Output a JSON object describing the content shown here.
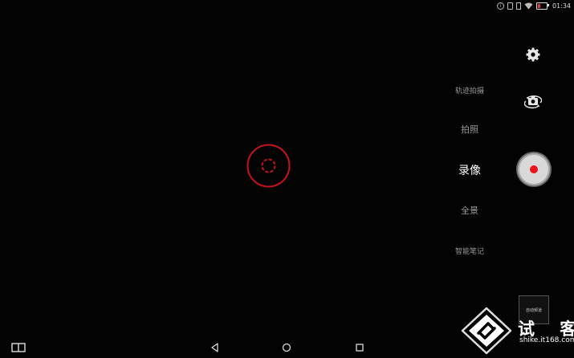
{
  "status_bar": {
    "time": "01:34",
    "icons": [
      "info-icon",
      "sim-icon",
      "device-icon",
      "wifi-icon",
      "battery-low-icon"
    ],
    "battery_color": "#e53935"
  },
  "camera": {
    "modes": [
      {
        "label": "轨迹拍摄",
        "active": false
      },
      {
        "label": "拍照",
        "active": false
      },
      {
        "label": "录像",
        "active": true
      },
      {
        "label": "全景",
        "active": false
      },
      {
        "label": "智能笔记",
        "active": false
      }
    ],
    "focus_ring_color": "#c4141a",
    "record_color": "#e8141b",
    "gallery_thumbnail_text": "自动频道"
  },
  "nav_bar": {
    "icons": [
      "split-screen-icon",
      "back-icon",
      "home-icon",
      "recents-icon"
    ]
  },
  "watermark": {
    "logo": "shike-logo",
    "text": "试 客",
    "url": "shike.it168.com"
  }
}
